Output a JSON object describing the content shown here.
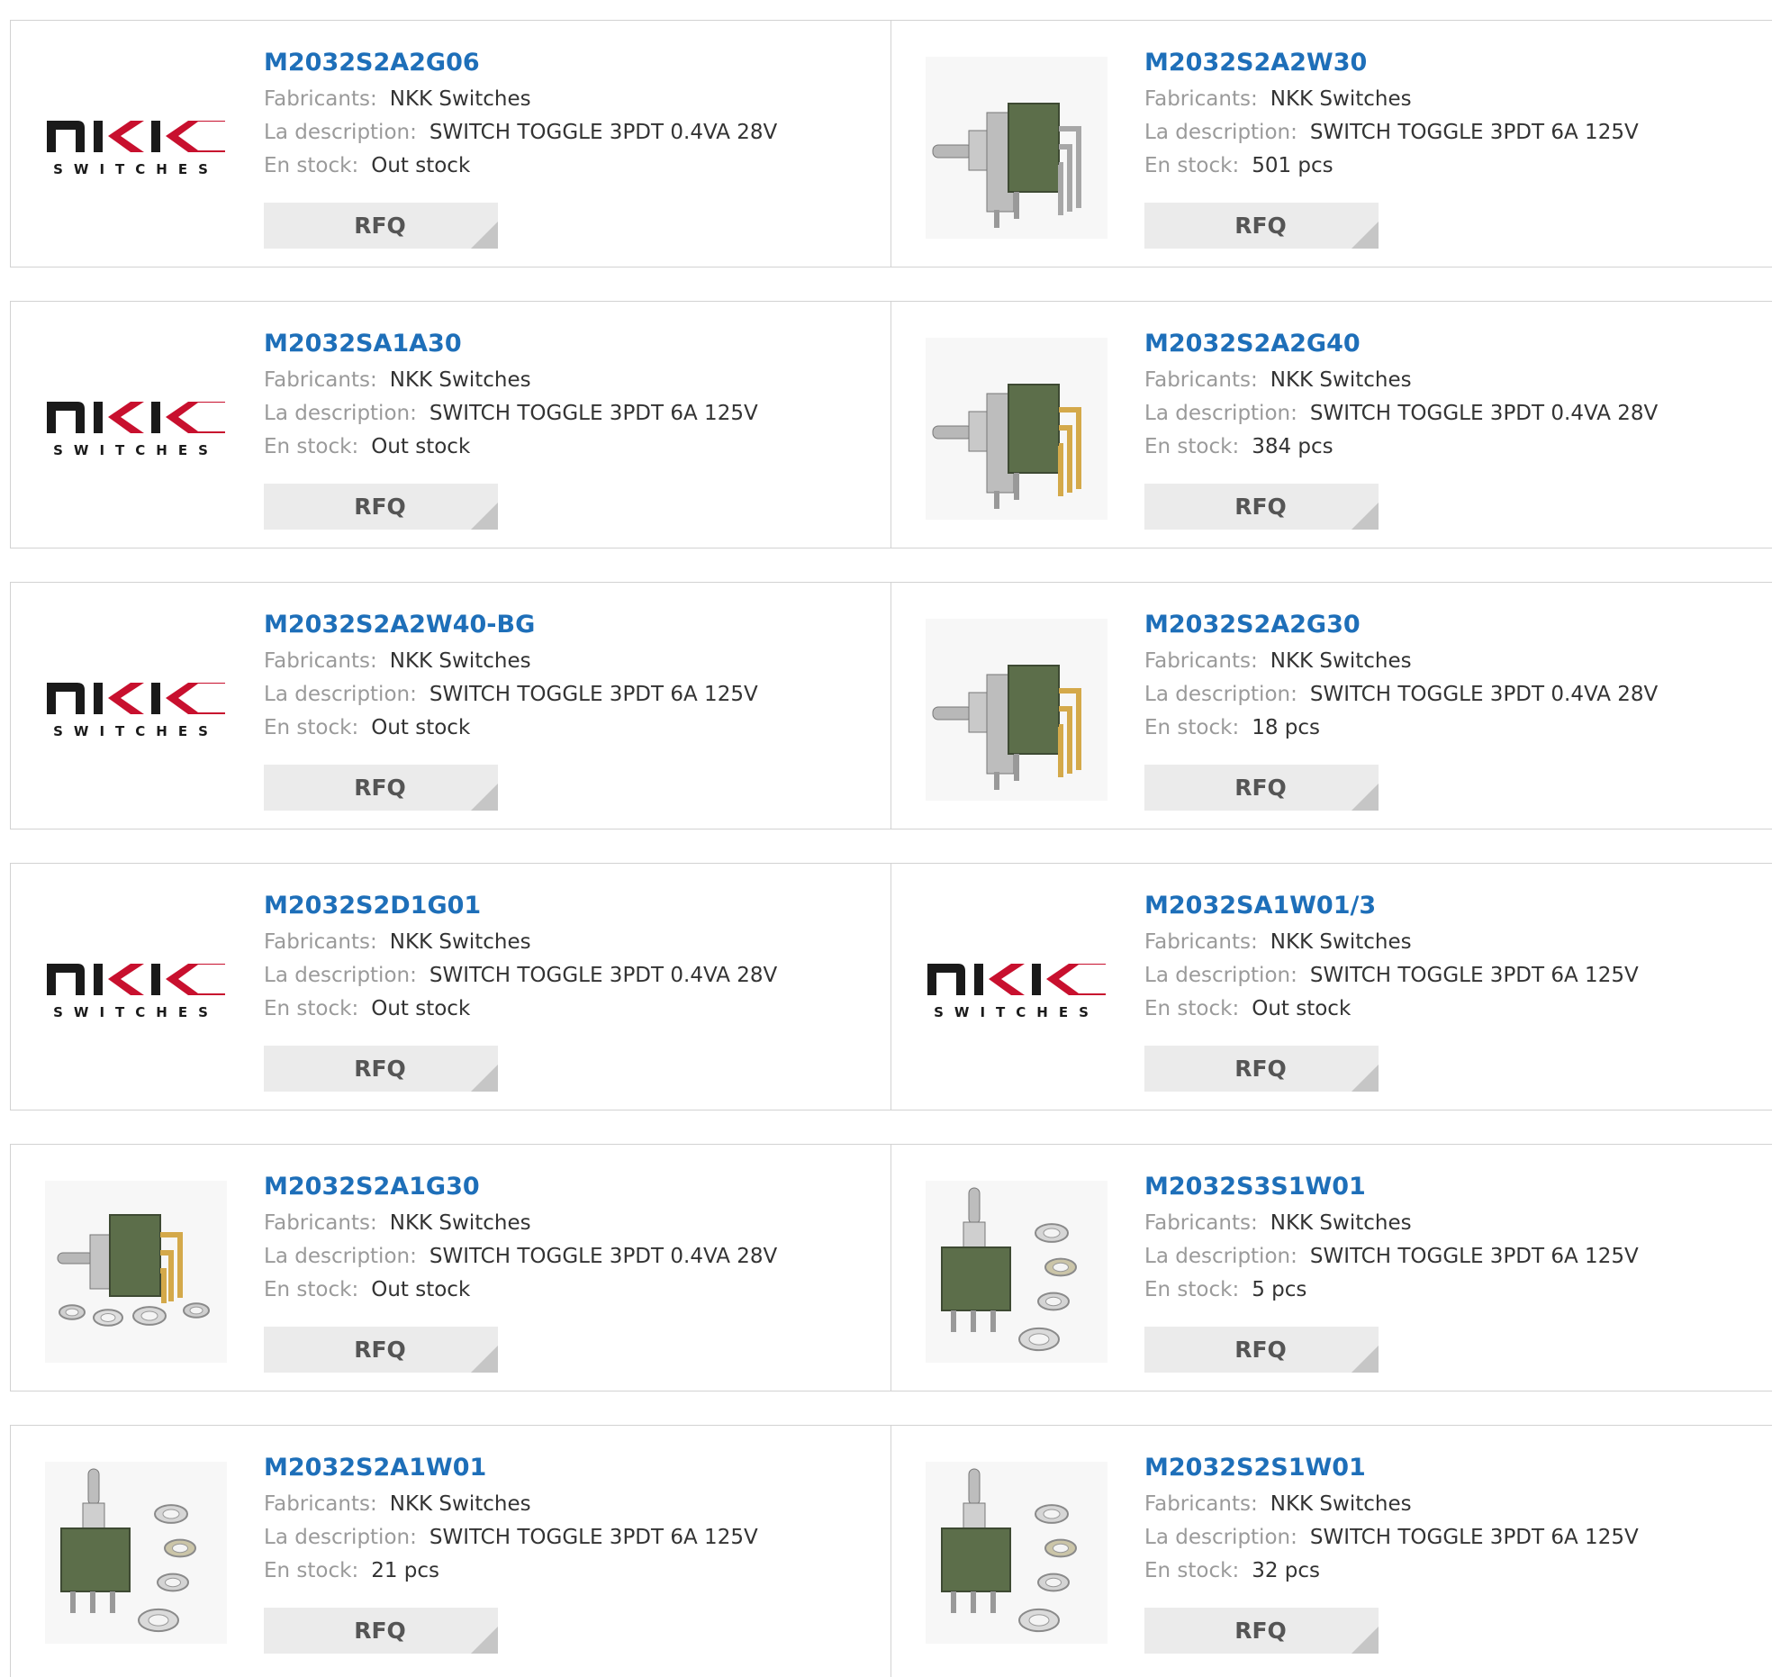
{
  "labels": {
    "manufacturer": "Fabricants:",
    "description": "La description:",
    "stock": "En stock:",
    "rfq": "RFQ"
  },
  "logo": {
    "mark": "NKK",
    "text": "SWITCHES"
  },
  "colors": {
    "link": "#1e6fb9",
    "button_bg": "#ebebeb",
    "button_corner": "#c6c6c6",
    "border": "#d2d2d2",
    "label": "#9a9a9a",
    "switch_body": "#5c6e4a"
  },
  "products": [
    {
      "part": "M2032S2A2G06",
      "manufacturer": "NKK Switches",
      "description": "SWITCH TOGGLE 3PDT 0.4VA 28V",
      "stock": "Out stock",
      "image": "nkk-logo"
    },
    {
      "part": "M2032S2A2W30",
      "manufacturer": "NKK Switches",
      "description": "SWITCH TOGGLE 3PDT 6A 125V",
      "stock": "501 pcs",
      "image": "toggle-switch-right-angle-silver"
    },
    {
      "part": "M2032SA1A30",
      "manufacturer": "NKK Switches",
      "description": "SWITCH TOGGLE 3PDT 6A 125V",
      "stock": "Out stock",
      "image": "nkk-logo"
    },
    {
      "part": "M2032S2A2G40",
      "manufacturer": "NKK Switches",
      "description": "SWITCH TOGGLE 3PDT 0.4VA 28V",
      "stock": "384 pcs",
      "image": "toggle-switch-right-angle-gold"
    },
    {
      "part": "M2032S2A2W40-BG",
      "manufacturer": "NKK Switches",
      "description": "SWITCH TOGGLE 3PDT 6A 125V",
      "stock": "Out stock",
      "image": "nkk-logo"
    },
    {
      "part": "M2032S2A2G30",
      "manufacturer": "NKK Switches",
      "description": "SWITCH TOGGLE 3PDT 0.4VA 28V",
      "stock": "18 pcs",
      "image": "toggle-switch-right-angle-gold"
    },
    {
      "part": "M2032S2D1G01",
      "manufacturer": "NKK Switches",
      "description": "SWITCH TOGGLE 3PDT 0.4VA 28V",
      "stock": "Out stock",
      "image": "nkk-logo"
    },
    {
      "part": "M2032SA1W01/3",
      "manufacturer": "NKK Switches",
      "description": "SWITCH TOGGLE 3PDT 6A 125V",
      "stock": "Out stock",
      "image": "nkk-logo"
    },
    {
      "part": "M2032S2A1G30",
      "manufacturer": "NKK Switches",
      "description": "SWITCH TOGGLE 3PDT 0.4VA 28V",
      "stock": "Out stock",
      "image": "toggle-switch-with-washers"
    },
    {
      "part": "M2032S3S1W01",
      "manufacturer": "NKK Switches",
      "description": "SWITCH TOGGLE 3PDT 6A 125V",
      "stock": "5 pcs",
      "image": "toggle-switch-vertical-with-washers"
    },
    {
      "part": "M2032S2A1W01",
      "manufacturer": "NKK Switches",
      "description": "SWITCH TOGGLE 3PDT 6A 125V",
      "stock": "21 pcs",
      "image": "toggle-switch-vertical-with-washers"
    },
    {
      "part": "M2032S2S1W01",
      "manufacturer": "NKK Switches",
      "description": "SWITCH TOGGLE 3PDT 6A 125V",
      "stock": "32 pcs",
      "image": "toggle-switch-vertical-with-washers"
    }
  ]
}
